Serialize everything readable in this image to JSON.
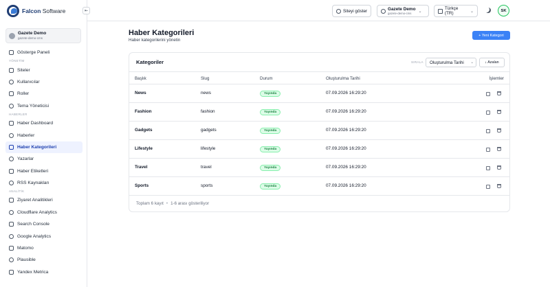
{
  "brand": {
    "bold": "Falcon",
    "rest": " Software"
  },
  "site_card": {
    "name": "Gazete Demo",
    "domain": "gazete-demo-cms"
  },
  "sidebar": {
    "groups": [
      {
        "section": "",
        "items": [
          {
            "label": "Gösterge Paneli",
            "icon": "dashboard-icon"
          }
        ]
      },
      {
        "section": "YÖNETİM",
        "items": [
          {
            "label": "Siteler",
            "icon": "sites-icon"
          },
          {
            "label": "Kullanıcılar",
            "icon": "users-icon"
          },
          {
            "label": "Roller",
            "icon": "roles-icon"
          },
          {
            "label": "Tema Yöneticisi",
            "icon": "theme-icon"
          }
        ]
      },
      {
        "section": "HABERLER",
        "items": [
          {
            "label": "Haber Dashboard",
            "icon": "news-dashboard-icon"
          },
          {
            "label": "Haberler",
            "icon": "news-icon"
          },
          {
            "label": "Haber Kategorileri",
            "icon": "categories-icon",
            "active": true
          },
          {
            "label": "Yazarlar",
            "icon": "authors-icon"
          },
          {
            "label": "Haber Etiketleri",
            "icon": "tags-icon"
          },
          {
            "label": "RSS Kaynakları",
            "icon": "rss-icon"
          }
        ]
      },
      {
        "section": "ANALİTİK",
        "items": [
          {
            "label": "Ziyaret Analitikleri",
            "icon": "analytics-icon"
          },
          {
            "label": "Cloudflare Analytics",
            "icon": "cloudflare-icon"
          },
          {
            "label": "Search Console",
            "icon": "search-console-icon"
          },
          {
            "label": "Google Analytics",
            "icon": "google-analytics-icon"
          },
          {
            "label": "Matomo",
            "icon": "matomo-icon"
          },
          {
            "label": "Plausible",
            "icon": "plausible-icon"
          },
          {
            "label": "Yandex Metrica",
            "icon": "yandex-icon"
          }
        ]
      }
    ]
  },
  "topbar": {
    "collapse_icon": "sidebar-collapse-icon",
    "view_site": "Siteyi göster",
    "site_name": "Gazete Demo",
    "site_domain": "gazete-demo-cms",
    "language": "Türkçe (TR)",
    "avatar_initials": "SK"
  },
  "page": {
    "title": "Haber Kategorileri",
    "subtitle": "Haber kategorilerini yönetin",
    "new_button": "+ Yeni Kategori"
  },
  "card": {
    "title": "Kategoriler",
    "sort_label": "SIRALA",
    "sort_value": "Oluşturulma Tarihi",
    "order_button": "↓ Azalan",
    "columns": [
      "Başlık",
      "Slug",
      "Durum",
      "Oluşturulma Tarihi",
      "İşlemler"
    ],
    "rows": [
      {
        "title": "News",
        "slug": "news",
        "status": "Yayında",
        "created": "07.09.2026 16:29:20"
      },
      {
        "title": "Fashion",
        "slug": "fashion",
        "status": "Yayında",
        "created": "07.09.2026 16:29:20"
      },
      {
        "title": "Gadgets",
        "slug": "gadgets",
        "status": "Yayında",
        "created": "07.09.2026 16:29:20"
      },
      {
        "title": "Lifestyle",
        "slug": "lifestyle",
        "status": "Yayında",
        "created": "07.09.2026 16:29:20"
      },
      {
        "title": "Travel",
        "slug": "travel",
        "status": "Yayında",
        "created": "07.09.2026 16:29:20"
      },
      {
        "title": "Sports",
        "slug": "sports",
        "status": "Yayında",
        "created": "07.09.2026 16:29:20"
      }
    ],
    "footer_total": "Toplam 6 kayıt",
    "footer_separator": "•",
    "footer_range": "1-6 arası gösteriliyor"
  },
  "colors": {
    "accent": "#3b82f6",
    "brand": "#1f3d73",
    "status_published": "#15803d",
    "avatar_ring": "#22c55e"
  }
}
